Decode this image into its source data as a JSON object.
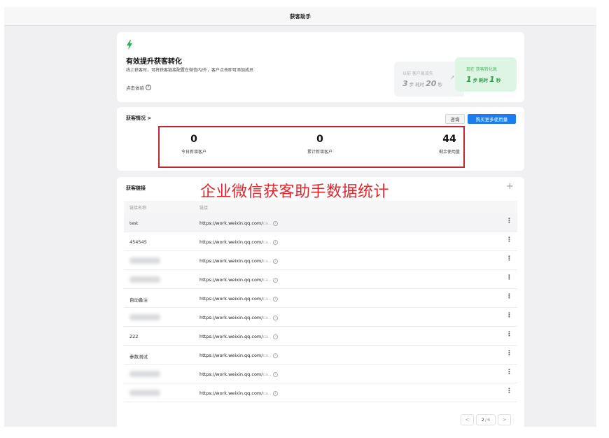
{
  "window": {
    "title": "获客助手"
  },
  "promo": {
    "title": "有效提升获客转化",
    "description": "线上获客时，可将获客链接配置在微信内/外，客户点击即可添加成员",
    "try_label": "点击体验",
    "before": {
      "label": "以前 客户易流失",
      "steps": "3",
      "steps_unit": "步",
      "time_prefix": "耗时",
      "time": "20",
      "time_unit": "秒"
    },
    "after": {
      "label": "现在 获客转化高",
      "steps": "1",
      "steps_unit": "步",
      "time_prefix": "耗时",
      "time": "1",
      "time_unit": "秒"
    }
  },
  "stats": {
    "title": "获客情况 >",
    "consult_label": "咨询",
    "buy_label": "购买更多使用量",
    "metrics": [
      {
        "value": "0",
        "label": "今日新增客户"
      },
      {
        "value": "0",
        "label": "累计新增客户"
      },
      {
        "value": "44",
        "label": "剩余使用量"
      }
    ]
  },
  "links": {
    "title": "获客链接",
    "add_icon": "+",
    "caption_overlay": "企业微信获客助手数据统计",
    "columns": [
      "链接名称",
      "链接"
    ],
    "url_path": "https://work.weixin.qq.com/",
    "url_ellipsis": "ca..",
    "rows": [
      {
        "name": "test",
        "blurred": false
      },
      {
        "name": "454545",
        "blurred": false
      },
      {
        "name": "",
        "blurred": true
      },
      {
        "name": "",
        "blurred": true
      },
      {
        "name": "自动备注",
        "blurred": false
      },
      {
        "name": "",
        "blurred": true
      },
      {
        "name": "222",
        "blurred": false
      },
      {
        "name": "参数测试",
        "blurred": false
      },
      {
        "name": "",
        "blurred": true
      },
      {
        "name": "",
        "blurred": true
      }
    ]
  },
  "pagination": {
    "current": "2",
    "separator": "/",
    "total": "6",
    "prev_icon": "<",
    "next_icon": ">"
  }
}
